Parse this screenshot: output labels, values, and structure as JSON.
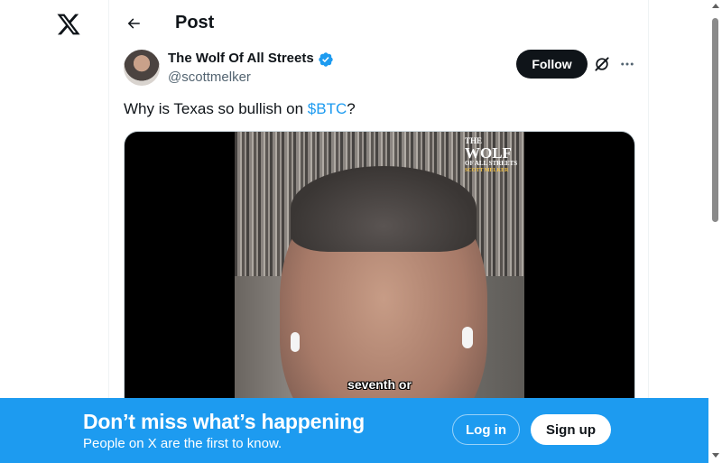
{
  "header": {
    "title": "Post"
  },
  "post": {
    "author": {
      "name": "The Wolf Of All Streets",
      "handle": "@scottmelker",
      "verified": true
    },
    "follow_label": "Follow",
    "text_before": "Why is Texas so bullish on ",
    "cashtag": "$BTC",
    "text_after": "?",
    "media": {
      "logo_line1": "THE",
      "logo_line2": "WOLF",
      "logo_line3": "OF ALL STREETS",
      "logo_line4": "SCOTT MELKER",
      "caption": "seventh or"
    }
  },
  "banner": {
    "title": "Don’t miss what’s happening",
    "subtitle": "People on X are the first to know.",
    "login_label": "Log in",
    "signup_label": "Sign up"
  },
  "icons": {
    "logo": "x-logo-icon",
    "back": "arrow-left-icon",
    "verified": "verified-badge-icon",
    "grok": "grok-icon",
    "more": "more-horizontal-icon"
  },
  "colors": {
    "accent": "#1d9bf0",
    "text": "#0f1419",
    "secondary_text": "#536471",
    "follow_bg": "#0f1419"
  }
}
